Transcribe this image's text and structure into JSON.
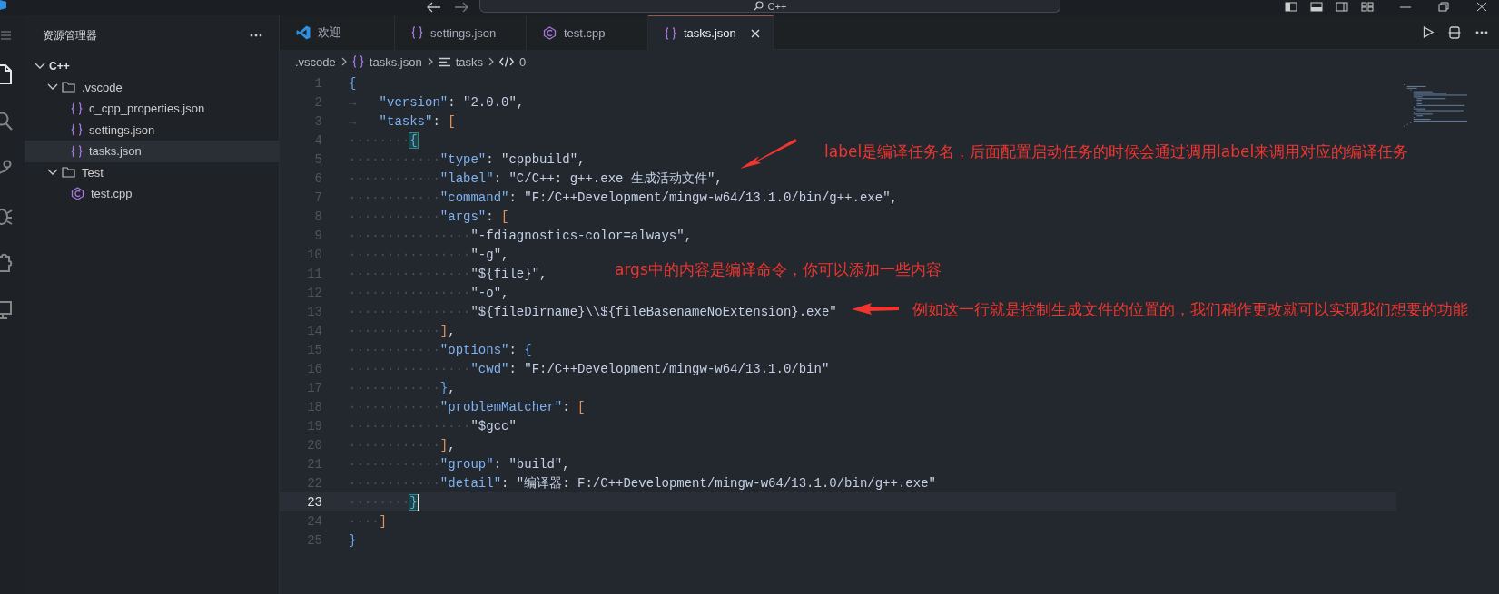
{
  "title_bar": {
    "search_text": "C++"
  },
  "activity_bar": {
    "items": [
      {
        "kind": "explorer",
        "selected": true
      },
      {
        "kind": "search",
        "selected": false
      },
      {
        "kind": "source-control",
        "selected": false
      },
      {
        "kind": "debug",
        "selected": false
      },
      {
        "kind": "extensions",
        "selected": false
      },
      {
        "kind": "remote",
        "selected": false
      }
    ]
  },
  "sidebar": {
    "title": "资源管理器",
    "tree": [
      {
        "label": "C++",
        "kind": "root",
        "expanded": true,
        "selected": false,
        "children": [
          {
            "label": ".vscode",
            "kind": "folder",
            "expanded": true,
            "selected": false,
            "children": [
              {
                "label": "c_cpp_properties.json",
                "kind": "json",
                "selected": false
              },
              {
                "label": "settings.json",
                "kind": "json",
                "selected": false
              },
              {
                "label": "tasks.json",
                "kind": "json",
                "selected": true
              }
            ]
          },
          {
            "label": "Test",
            "kind": "folder",
            "expanded": true,
            "selected": false,
            "children": [
              {
                "label": "test.cpp",
                "kind": "cpp",
                "selected": false
              }
            ]
          }
        ]
      }
    ]
  },
  "tabs": [
    {
      "label": "欢迎",
      "kind": "welcome",
      "selected": false
    },
    {
      "label": "settings.json",
      "kind": "json",
      "selected": false
    },
    {
      "label": "test.cpp",
      "kind": "cpp",
      "selected": false
    },
    {
      "label": "tasks.json",
      "kind": "json",
      "selected": true
    }
  ],
  "breadcrumb": [
    {
      "label": ".vscode",
      "kind": "folder"
    },
    {
      "label": "tasks.json",
      "kind": "json"
    },
    {
      "label": "tasks",
      "kind": "array"
    },
    {
      "label": "0",
      "kind": "object"
    }
  ],
  "editor": {
    "lines": [
      {
        "number": "1",
        "current": false,
        "tokens": [
          {
            "kind": "brace",
            "text": "{"
          }
        ]
      },
      {
        "number": "2",
        "current": false,
        "lead": {
          "kind": "tab",
          "text": "→"
        },
        "tokens": [
          {
            "kind": "key",
            "text": "\"version\""
          },
          {
            "kind": "punct",
            "text": ": "
          },
          {
            "kind": "string",
            "text": "\"2.0.0\""
          },
          {
            "kind": "punct",
            "text": ","
          }
        ]
      },
      {
        "number": "3",
        "current": false,
        "lead": {
          "kind": "tab",
          "text": "→"
        },
        "tokens": [
          {
            "kind": "key",
            "text": "\"tasks\""
          },
          {
            "kind": "punct",
            "text": ": "
          },
          {
            "kind": "bracket",
            "text": "["
          }
        ]
      },
      {
        "number": "4",
        "current": false,
        "lead": {
          "kind": "spaces",
          "text": "········"
        },
        "tokens": [
          {
            "kind": "matched_brace",
            "text": "{"
          }
        ]
      },
      {
        "number": "5",
        "current": false,
        "lead": {
          "kind": "spaces",
          "text": "············"
        },
        "tokens": [
          {
            "kind": "key",
            "text": "\"type\""
          },
          {
            "kind": "punct",
            "text": ": "
          },
          {
            "kind": "string",
            "text": "\"cppbuild\""
          },
          {
            "kind": "punct",
            "text": ","
          }
        ]
      },
      {
        "number": "6",
        "current": false,
        "lead": {
          "kind": "spaces",
          "text": "············"
        },
        "tokens": [
          {
            "kind": "key",
            "text": "\"label\""
          },
          {
            "kind": "punct",
            "text": ": "
          },
          {
            "kind": "string",
            "text": "\"C/C++: g++.exe 生成活动文件\""
          },
          {
            "kind": "punct",
            "text": ","
          }
        ]
      },
      {
        "number": "7",
        "current": false,
        "lead": {
          "kind": "spaces",
          "text": "············"
        },
        "tokens": [
          {
            "kind": "key",
            "text": "\"command\""
          },
          {
            "kind": "punct",
            "text": ": "
          },
          {
            "kind": "string",
            "text": "\"F:/C++Development/mingw-w64/13.1.0/bin/g++.exe\""
          },
          {
            "kind": "punct",
            "text": ","
          }
        ]
      },
      {
        "number": "8",
        "current": false,
        "lead": {
          "kind": "spaces",
          "text": "············"
        },
        "tokens": [
          {
            "kind": "key",
            "text": "\"args\""
          },
          {
            "kind": "punct",
            "text": ": "
          },
          {
            "kind": "bracket",
            "text": "["
          }
        ]
      },
      {
        "number": "9",
        "current": false,
        "lead": {
          "kind": "spaces",
          "text": "················"
        },
        "tokens": [
          {
            "kind": "string",
            "text": "\"-fdiagnostics-color=always\""
          },
          {
            "kind": "punct",
            "text": ","
          }
        ]
      },
      {
        "number": "10",
        "current": false,
        "lead": {
          "kind": "spaces",
          "text": "················"
        },
        "tokens": [
          {
            "kind": "string",
            "text": "\"-g\""
          },
          {
            "kind": "punct",
            "text": ","
          }
        ]
      },
      {
        "number": "11",
        "current": false,
        "lead": {
          "kind": "spaces",
          "text": "················"
        },
        "tokens": [
          {
            "kind": "string",
            "text": "\"${file}\""
          },
          {
            "kind": "punct",
            "text": ","
          }
        ]
      },
      {
        "number": "12",
        "current": false,
        "lead": {
          "kind": "spaces",
          "text": "················"
        },
        "tokens": [
          {
            "kind": "string",
            "text": "\"-o\""
          },
          {
            "kind": "punct",
            "text": ","
          }
        ]
      },
      {
        "number": "13",
        "current": false,
        "lead": {
          "kind": "spaces",
          "text": "················"
        },
        "tokens": [
          {
            "kind": "string",
            "text": "\"${fileDirname}\\\\${fileBasenameNoExtension}.exe\""
          }
        ]
      },
      {
        "number": "14",
        "current": false,
        "lead": {
          "kind": "spaces",
          "text": "············"
        },
        "tokens": [
          {
            "kind": "bracket",
            "text": "]"
          },
          {
            "kind": "punct",
            "text": ","
          }
        ]
      },
      {
        "number": "15",
        "current": false,
        "lead": {
          "kind": "spaces",
          "text": "············"
        },
        "tokens": [
          {
            "kind": "key",
            "text": "\"options\""
          },
          {
            "kind": "punct",
            "text": ": "
          },
          {
            "kind": "brace",
            "text": "{"
          }
        ]
      },
      {
        "number": "16",
        "current": false,
        "lead": {
          "kind": "spaces",
          "text": "················"
        },
        "tokens": [
          {
            "kind": "key",
            "text": "\"cwd\""
          },
          {
            "kind": "punct",
            "text": ": "
          },
          {
            "kind": "string",
            "text": "\"F:/C++Development/mingw-w64/13.1.0/bin\""
          }
        ]
      },
      {
        "number": "17",
        "current": false,
        "lead": {
          "kind": "spaces",
          "text": "············"
        },
        "tokens": [
          {
            "kind": "brace",
            "text": "}"
          },
          {
            "kind": "punct",
            "text": ","
          }
        ]
      },
      {
        "number": "18",
        "current": false,
        "lead": {
          "kind": "spaces",
          "text": "············"
        },
        "tokens": [
          {
            "kind": "key",
            "text": "\"problemMatcher\""
          },
          {
            "kind": "punct",
            "text": ": "
          },
          {
            "kind": "bracket",
            "text": "["
          }
        ]
      },
      {
        "number": "19",
        "current": false,
        "lead": {
          "kind": "spaces",
          "text": "················"
        },
        "tokens": [
          {
            "kind": "string",
            "text": "\"$gcc\""
          }
        ]
      },
      {
        "number": "20",
        "current": false,
        "lead": {
          "kind": "spaces",
          "text": "············"
        },
        "tokens": [
          {
            "kind": "bracket",
            "text": "]"
          },
          {
            "kind": "punct",
            "text": ","
          }
        ]
      },
      {
        "number": "21",
        "current": false,
        "lead": {
          "kind": "spaces",
          "text": "············"
        },
        "tokens": [
          {
            "kind": "key",
            "text": "\"group\""
          },
          {
            "kind": "punct",
            "text": ": "
          },
          {
            "kind": "string",
            "text": "\"build\""
          },
          {
            "kind": "punct",
            "text": ","
          }
        ]
      },
      {
        "number": "22",
        "current": false,
        "lead": {
          "kind": "spaces",
          "text": "············"
        },
        "tokens": [
          {
            "kind": "key",
            "text": "\"detail\""
          },
          {
            "kind": "punct",
            "text": ": "
          },
          {
            "kind": "string",
            "text": "\"编译器: F:/C++Development/mingw-w64/13.1.0/bin/g++.exe\""
          }
        ]
      },
      {
        "number": "23",
        "current": true,
        "lead": {
          "kind": "spaces",
          "text": "········"
        },
        "tokens": [
          {
            "kind": "matched_brace",
            "text": "}"
          }
        ]
      },
      {
        "number": "24",
        "current": false,
        "lead": {
          "kind": "spaces",
          "text": "····"
        },
        "tokens": [
          {
            "kind": "bracket",
            "text": "]"
          }
        ]
      },
      {
        "number": "25",
        "current": false,
        "tokens": [
          {
            "kind": "brace",
            "text": "}"
          }
        ]
      }
    ]
  },
  "annotations": [
    {
      "text": "label是编译任务名，后面配置启动任务的时候会通过调用label来调用对应的编译任务",
      "kind": "note"
    },
    {
      "text": "args中的内容是编译命令，你可以添加一些内容",
      "kind": "note"
    },
    {
      "text": "例如这一行就是控制生成文件的位置的，我们稍作更改就可以实现我们想要的功能",
      "kind": "note"
    }
  ]
}
